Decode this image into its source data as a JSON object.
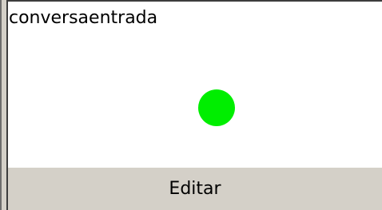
{
  "panel": {
    "title": "conversaentrada",
    "status_color": "#00ee00"
  },
  "footer": {
    "edit_label": "Editar"
  },
  "colors": {
    "background": "#d4d0c8",
    "panel": "#ffffff",
    "status": "#00ee00"
  }
}
